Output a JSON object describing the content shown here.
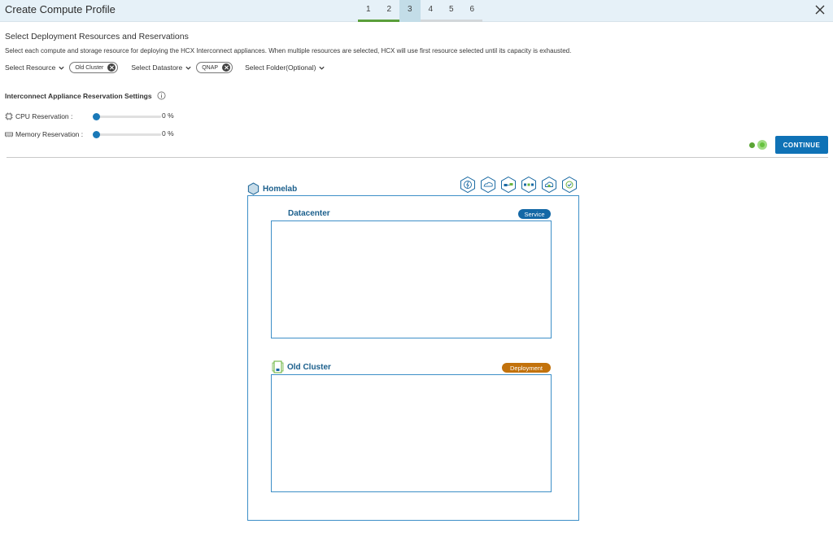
{
  "header": {
    "title": "Create Compute Profile",
    "steps": [
      "1",
      "2",
      "3",
      "4",
      "5",
      "6"
    ],
    "current_step": 3
  },
  "section": {
    "title": "Select Deployment Resources and Reservations",
    "description": "Select each compute and storage resource for deploying the HCX Interconnect appliances. When multiple resources are selected, HCX will use first resource selected until its capacity is exhausted."
  },
  "selectors": {
    "resource_label": "Select Resource",
    "resource_chip": "Old Cluster",
    "datastore_label": "Select Datastore",
    "datastore_chip": "QNAP",
    "folder_label": "Select Folder(Optional)"
  },
  "reservation": {
    "title": "Interconnect Appliance Reservation Settings",
    "cpu_label": "CPU Reservation :",
    "cpu_value": "0 %",
    "memory_label": "Memory Reservation :",
    "memory_value": "0 %"
  },
  "actions": {
    "continue_label": "CONTINUE"
  },
  "diagram": {
    "site_name": "Homelab",
    "datacenter_label": "Datacenter",
    "datacenter_badge": "Service",
    "cluster_label": "Old Cluster",
    "cluster_badge": "Deployment",
    "service_icons": [
      "interconnect-icon",
      "wan-optimization-icon",
      "network-extension-icon",
      "bulk-migration-icon",
      "cloud-migration-icon",
      "disaster-recovery-icon"
    ]
  },
  "colors": {
    "accent": "#0f72b6",
    "header_bg": "#e6f1f8",
    "service_badge": "#1468a6",
    "deployment_badge": "#c2720c",
    "step_done": "#5a9e3a"
  }
}
